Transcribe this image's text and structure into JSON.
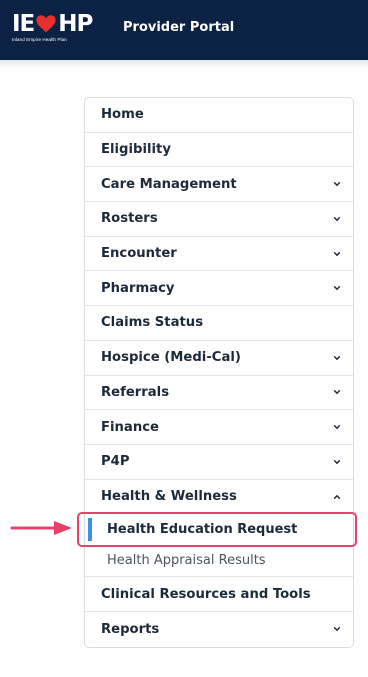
{
  "header": {
    "logo_text_left": "IE",
    "logo_text_right": "HP",
    "logo_subtitle": "Inland Empire Health Plan",
    "portal_title": "Provider Portal"
  },
  "menu": {
    "items": [
      {
        "label": "Home",
        "has_chevron": false
      },
      {
        "label": "Eligibility",
        "has_chevron": false
      },
      {
        "label": "Care Management",
        "has_chevron": true
      },
      {
        "label": "Rosters",
        "has_chevron": true
      },
      {
        "label": "Encounter",
        "has_chevron": true
      },
      {
        "label": "Pharmacy",
        "has_chevron": true
      },
      {
        "label": "Claims Status",
        "has_chevron": false
      },
      {
        "label": "Hospice (Medi-Cal)",
        "has_chevron": true
      },
      {
        "label": "Referrals",
        "has_chevron": true
      },
      {
        "label": "Finance",
        "has_chevron": true
      },
      {
        "label": "P4P",
        "has_chevron": true
      },
      {
        "label": "Health & Wellness",
        "has_chevron": true,
        "expanded": true
      },
      {
        "label": "Clinical Resources and Tools",
        "has_chevron": false
      },
      {
        "label": "Reports",
        "has_chevron": true
      }
    ],
    "health_wellness_sub": [
      {
        "label": "Health Education Request",
        "active": true
      },
      {
        "label": "Health Appraisal Results",
        "active": false
      }
    ]
  },
  "colors": {
    "header_bg": "#0b2244",
    "accent_blue": "#3f8fe6",
    "highlight_pink": "#e8416e",
    "logo_heart": "#e8312f"
  }
}
